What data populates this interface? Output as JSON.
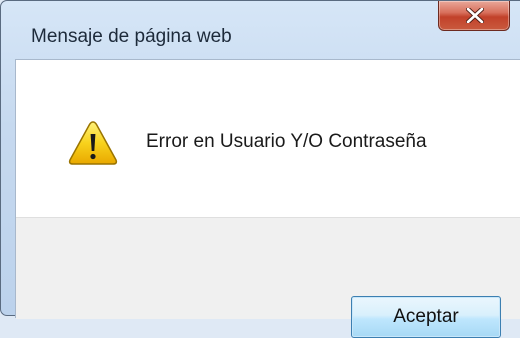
{
  "dialog": {
    "title": "Mensaje de página web",
    "message": "Error en Usuario Y/O Contraseña",
    "accept_label": "Aceptar",
    "icon": "warning-icon",
    "close_icon": "close-icon"
  },
  "colors": {
    "close_button": "#c9442c",
    "accept_border": "#3c7fb1",
    "footer": "#f0f0f0",
    "warning_yellow": "#f5c400"
  }
}
